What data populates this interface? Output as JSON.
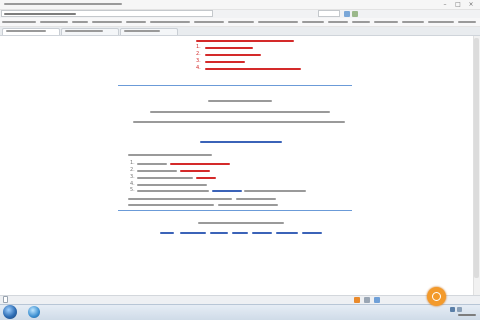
{
  "window": {
    "controls": [
      {
        "name": "minimize",
        "glyph": "–"
      },
      {
        "name": "maximize",
        "glyph": "□"
      },
      {
        "name": "close",
        "glyph": "×"
      }
    ]
  },
  "colors": {
    "notice_red": "#d42a2a",
    "rule_blue": "#6b9bd8",
    "link_blue": "#3b63b8",
    "chrome": "#eef0f3",
    "taskbar": "#d6e0ec",
    "badge_orange": "#f39a2b",
    "start_orb": "#2e6db4"
  },
  "notice": {
    "items": [
      {
        "number": "1."
      },
      {
        "number": "2."
      },
      {
        "number": "3."
      },
      {
        "number": "4."
      }
    ]
  },
  "instructions": {
    "items": [
      {
        "number": "1."
      },
      {
        "number": "2."
      },
      {
        "number": "3."
      },
      {
        "number": "4."
      },
      {
        "number": "5."
      }
    ]
  },
  "icons": {
    "start": "windows-start-orb-icon",
    "browser": "browser-icon",
    "badge": "orange-tray-icon",
    "page": "page-icon"
  }
}
